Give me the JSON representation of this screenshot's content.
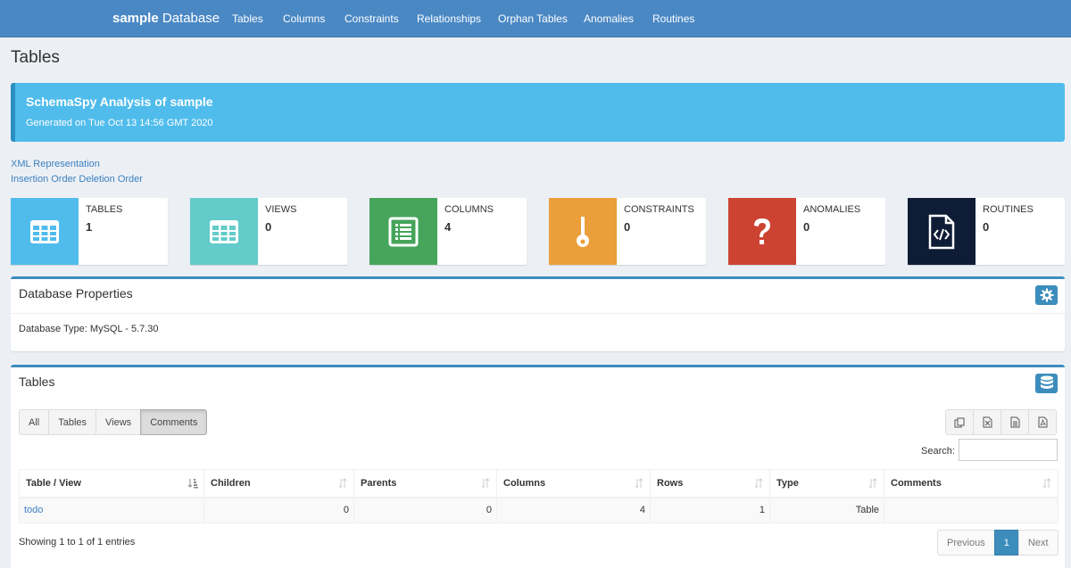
{
  "navbar": {
    "brand_bold": "sample",
    "brand_rest": "Database",
    "items": [
      "Tables",
      "Columns",
      "Constraints",
      "Relationships",
      "Orphan Tables",
      "Anomalies",
      "Routines"
    ]
  },
  "page_title": "Tables",
  "callout": {
    "title": "SchemaSpy Analysis of sample",
    "subtitle": "Generated on Tue Oct 13 14:56 GMT 2020"
  },
  "links": {
    "xml": "XML Representation",
    "order": "Insertion Order Deletion Order"
  },
  "info_boxes": [
    {
      "label": "TABLES",
      "value": "1",
      "icon": "table-icon",
      "color": "#50bcec"
    },
    {
      "label": "VIEWS",
      "value": "0",
      "icon": "table-icon",
      "color": "#63cbca"
    },
    {
      "label": "COLUMNS",
      "value": "4",
      "icon": "list-icon",
      "color": "#46a55b"
    },
    {
      "label": "CONSTRAINTS",
      "value": "0",
      "icon": "key-icon",
      "color": "#eb9f3a"
    },
    {
      "label": "ANOMALIES",
      "value": "0",
      "icon": "question-icon",
      "color": "#cc4332"
    },
    {
      "label": "ROUTINES",
      "value": "0",
      "icon": "code-file-icon",
      "color": "#0f1c36"
    }
  ],
  "db_properties": {
    "title": "Database Properties",
    "db_type": "Database Type: MySQL - 5.7.30"
  },
  "tables_box": {
    "title": "Tables",
    "filters": [
      "All",
      "Tables",
      "Views",
      "Comments"
    ],
    "active_filter": "Comments",
    "export_icons": [
      "copy-icon",
      "excel-icon",
      "csv-icon",
      "pdf-icon"
    ],
    "search_label": "Search:",
    "search_value": "",
    "columns": [
      "Table / View",
      "Children",
      "Parents",
      "Columns",
      "Rows",
      "Type",
      "Comments"
    ],
    "rows": [
      {
        "name": "todo",
        "children": "0",
        "parents": "0",
        "columns": "4",
        "rows": "1",
        "type": "Table",
        "comments": ""
      }
    ],
    "info": "Showing 1 to 1 of 1 entries",
    "pager": {
      "prev": "Previous",
      "current": "1",
      "next": "Next"
    }
  },
  "colors": {
    "navbar": "#4a88c4",
    "callout": "#50bcec",
    "box_accent": "#3c8dbc",
    "link": "#3c7fbf"
  }
}
